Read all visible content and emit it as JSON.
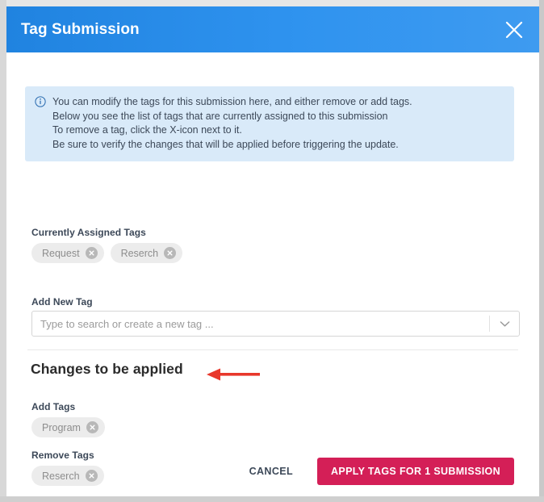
{
  "dialog": {
    "title": "Tag Submission",
    "close_icon": "close-icon",
    "header_color": "#2f93ef"
  },
  "info_box": {
    "icon": "info-circle-icon",
    "background_color": "#d9eaf9",
    "lines": [
      "You can modify the tags for this submission here, and either remove or add tags.",
      "Below you see the list of tags that are currently assigned to this submission",
      "To remove a tag, click the X-icon next to it.",
      "Be sure to verify the changes that will be applied before triggering the update."
    ]
  },
  "currently_assigned": {
    "label": "Currently Assigned Tags",
    "tags": [
      {
        "name": "Request",
        "remove_icon": "remove-circle-icon"
      },
      {
        "name": "Reserch",
        "remove_icon": "remove-circle-icon"
      }
    ]
  },
  "add_new_tag": {
    "label": "Add New Tag",
    "placeholder": "Type to search or create a new tag ...",
    "value": "",
    "dropdown_icon": "chevron-down-icon"
  },
  "changes": {
    "heading": "Changes to be applied",
    "annotation_arrow": {
      "icon": "left-arrow-annotation",
      "color": "#e8372b",
      "direction": "left"
    },
    "add": {
      "label": "Add Tags",
      "tags": [
        {
          "name": "Program",
          "remove_icon": "remove-circle-icon"
        }
      ]
    },
    "remove": {
      "label": "Remove Tags",
      "tags": [
        {
          "name": "Reserch",
          "remove_icon": "remove-circle-icon"
        }
      ]
    }
  },
  "footer": {
    "cancel_label": "CANCEL",
    "apply_label": "APPLY TAGS FOR 1 SUBMISSION",
    "apply_color": "#d41f57"
  }
}
